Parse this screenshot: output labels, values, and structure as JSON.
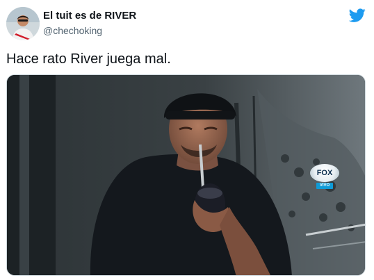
{
  "tweet": {
    "author_name": "El tuit es de RIVER",
    "author_handle": "@chechoking",
    "text": "Hace rato River juega mal."
  },
  "media": {
    "broadcast_logo": "FOX",
    "broadcast_tag": "VIVO"
  },
  "icons": {
    "platform": "twitter-bird-icon",
    "avatar": "avatar-image"
  },
  "colors": {
    "twitter_blue": "#1d9bf0",
    "name_text": "#0f1419",
    "handle_text": "#536471",
    "broadcast_tag": "#0f9bd7"
  }
}
